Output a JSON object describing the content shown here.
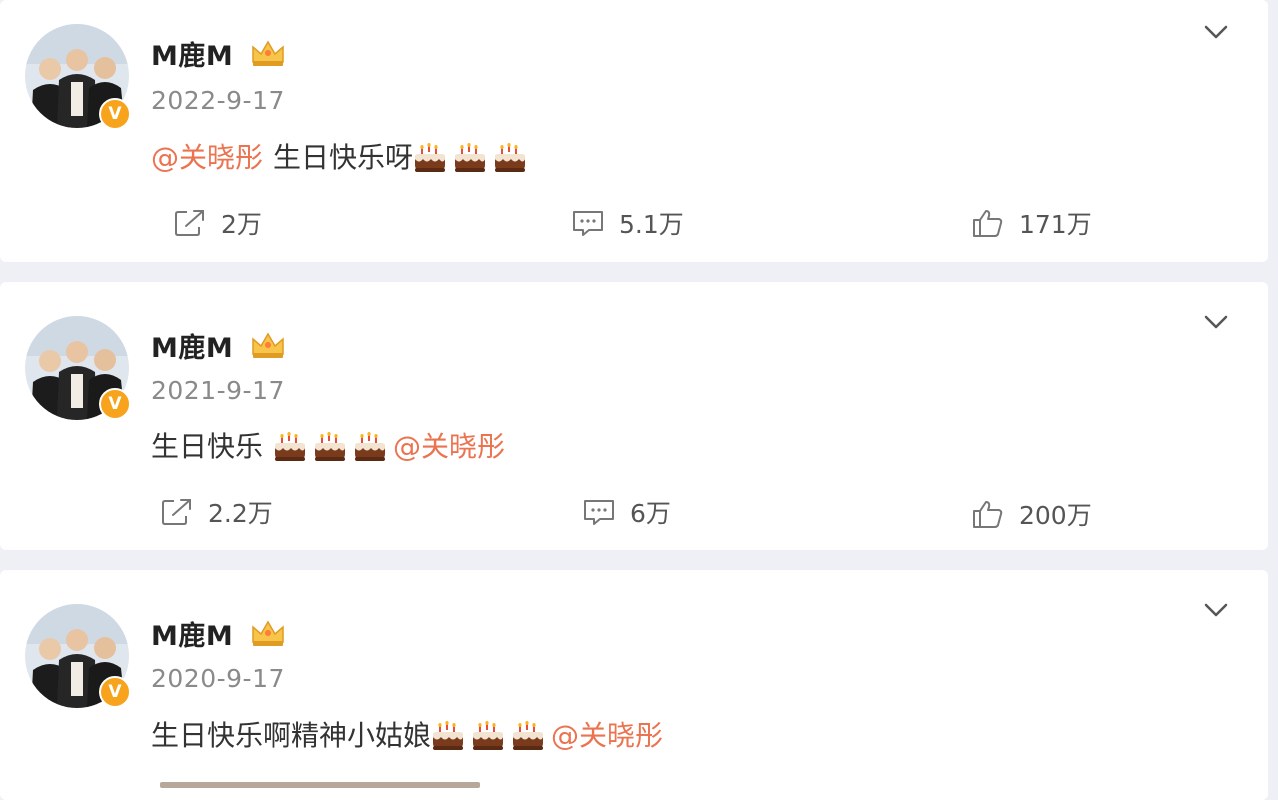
{
  "posts": [
    {
      "username": "M鹿M",
      "date": "2022-9-17",
      "content": {
        "pre": "",
        "mention_before": "@关晓彤",
        "text": "生日快乐呀",
        "cakes": 3,
        "mention_after": ""
      },
      "repost": "2万",
      "comments": "5.1万",
      "likes": "171万"
    },
    {
      "username": "M鹿M",
      "date": "2021-9-17",
      "content": {
        "pre": "生日快乐",
        "mention_before": "",
        "text": "",
        "cakes": 3,
        "mention_after": "@关晓彤"
      },
      "repost": "2.2万",
      "comments": "6万",
      "likes": "200万"
    },
    {
      "username": "M鹿M",
      "date": "2020-9-17",
      "content": {
        "pre": "生日快乐啊精神小姑娘",
        "mention_before": "",
        "text": "",
        "cakes": 3,
        "mention_after": "@关晓彤"
      },
      "repost": "",
      "comments": "",
      "likes": ""
    }
  ],
  "icons": {
    "verified": "V",
    "crown": "crown-icon",
    "more": "chevron-down-icon",
    "repost": "repost-icon",
    "comment": "comment-icon",
    "like": "thumbs-up-icon",
    "cake": "cake-emoji"
  },
  "colors": {
    "mention": "#eb7350",
    "badge": "#f7a31b",
    "background": "#eef0f5"
  }
}
